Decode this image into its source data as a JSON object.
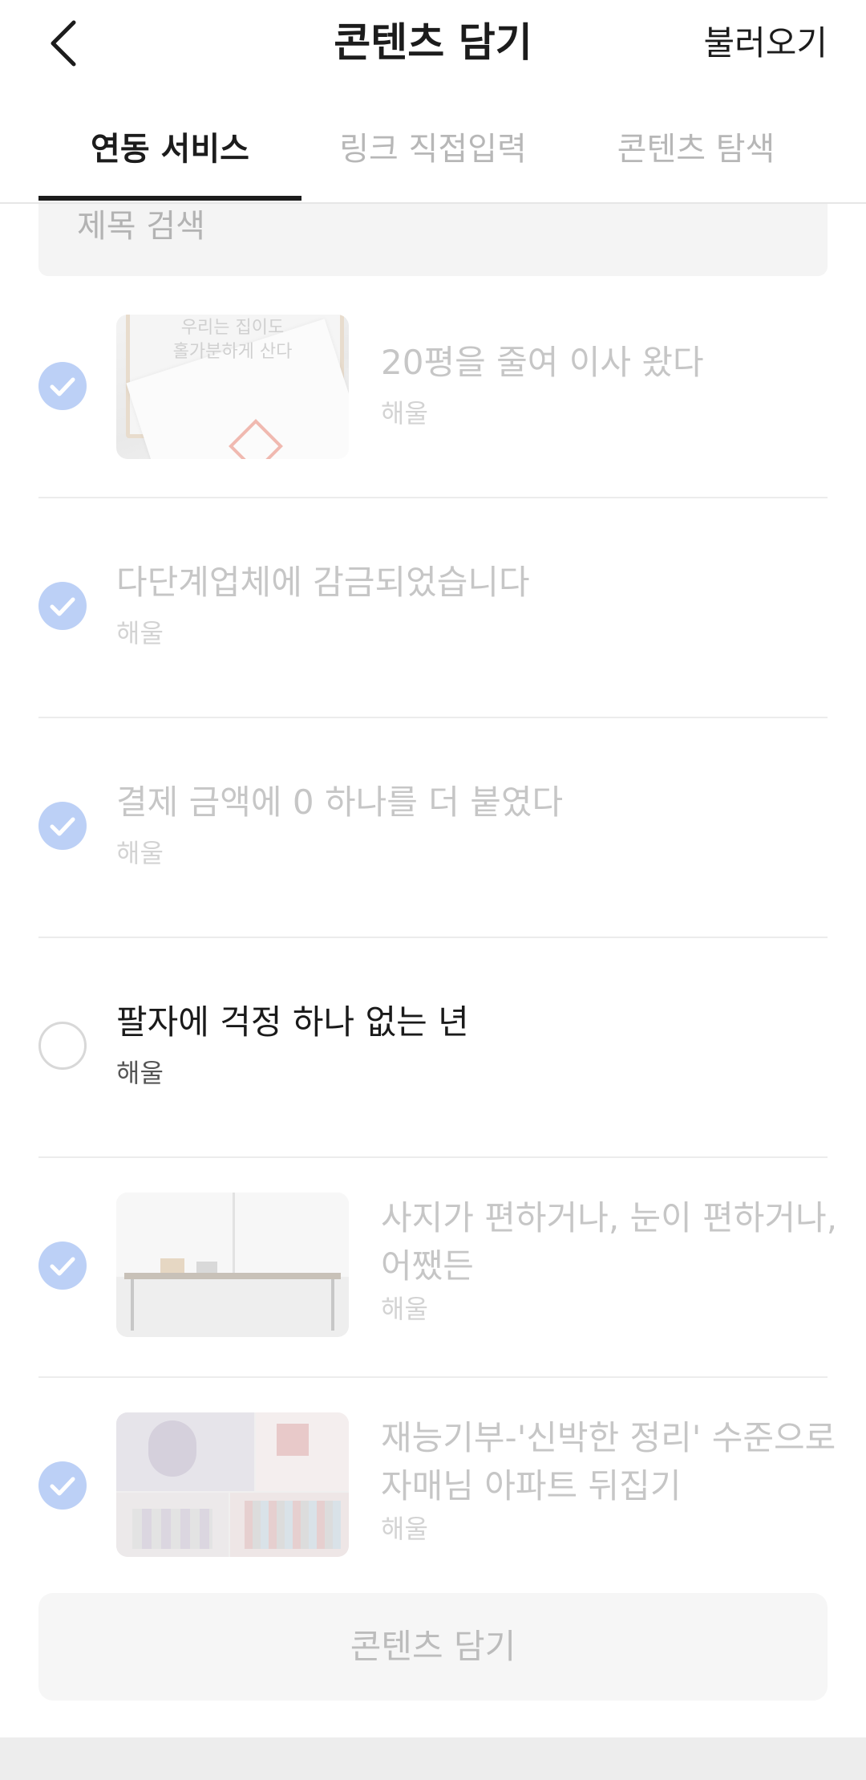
{
  "header": {
    "title": "콘텐츠 담기",
    "action_label": "불러오기",
    "back_icon": "chevron-left-icon"
  },
  "tabs": [
    {
      "label": "연동 서비스",
      "active": true
    },
    {
      "label": "링크 직접입력",
      "active": false
    },
    {
      "label": "콘텐츠 탐색",
      "active": false
    }
  ],
  "search": {
    "placeholder": "제목 검색"
  },
  "items": [
    {
      "title": "20평을 줄여 이사 왔다",
      "author": "해울",
      "checked": true,
      "has_thumbnail": true,
      "thumb_text": "우리는 집이도\n홀가분하게 산다"
    },
    {
      "title": "다단계업체에 감금되었습니다",
      "author": "해울",
      "checked": true,
      "has_thumbnail": false
    },
    {
      "title": "결제 금액에 0 하나를 더 붙였다",
      "author": "해울",
      "checked": true,
      "has_thumbnail": false
    },
    {
      "title": "팔자에 걱정 하나 없는 년",
      "author": "해울",
      "checked": false,
      "has_thumbnail": false
    },
    {
      "title": "사지가 편하거나, 눈이 편하거나, 어쨌든",
      "author": "해울",
      "checked": true,
      "has_thumbnail": true
    },
    {
      "title": "재능기부-'신박한 정리' 수준으로 자매님 아파트 뒤집기",
      "author": "해울",
      "checked": true,
      "has_thumbnail": true
    }
  ],
  "bottom_button": {
    "label": "콘텐츠 담기"
  },
  "colors": {
    "accent_check": "#bcd0f6",
    "text_active": "#1a1a1a",
    "text_disabled": "#c6c6c6"
  }
}
